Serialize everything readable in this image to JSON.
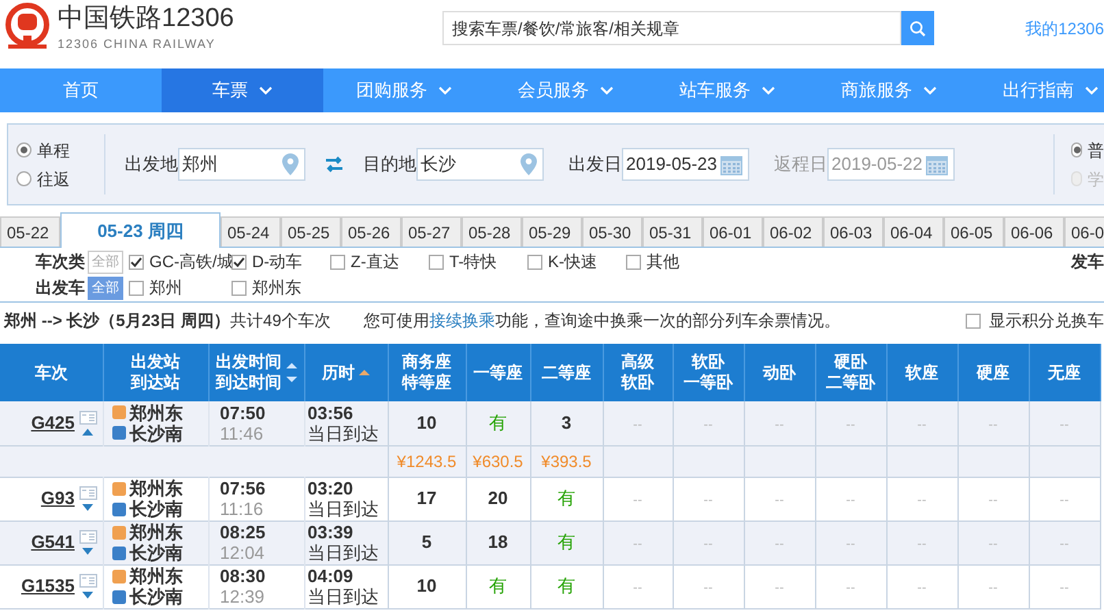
{
  "header": {
    "logo_title": "中国铁路12306",
    "logo_subtitle": "12306 CHINA RAILWAY",
    "search": {
      "placeholder": "搜索车票/餐饮/常旅客/相关规章"
    },
    "account_link": "我的12306"
  },
  "nav": [
    {
      "label": "首页",
      "selected": false,
      "has_menu": false
    },
    {
      "label": "车票",
      "selected": true,
      "has_menu": true
    },
    {
      "label": "团购服务",
      "selected": false,
      "has_menu": true
    },
    {
      "label": "会员服务",
      "selected": false,
      "has_menu": true
    },
    {
      "label": "站车服务",
      "selected": false,
      "has_menu": true
    },
    {
      "label": "商旅服务",
      "selected": false,
      "has_menu": true
    },
    {
      "label": "出行指南",
      "selected": false,
      "has_menu": true
    }
  ],
  "query": {
    "trip_types": [
      {
        "label": "单程",
        "selected": true
      },
      {
        "label": "往返",
        "selected": false
      }
    ],
    "from": {
      "label": "出发地",
      "value": "郑州"
    },
    "to": {
      "label": "目的地",
      "value": "长沙"
    },
    "depart_date": {
      "label": "出发日",
      "value": "2019-05-23",
      "disabled": false
    },
    "return_date": {
      "label": "返程日",
      "value": "2019-05-22",
      "disabled": true
    },
    "passenger_types": [
      {
        "label": "普",
        "selected": true,
        "disabled": false
      },
      {
        "label": "学",
        "selected": false,
        "disabled": true
      }
    ]
  },
  "date_tabs": [
    {
      "label": "05-22",
      "selected": false
    },
    {
      "label": "05-23 周四",
      "selected": true
    },
    {
      "label": "05-24",
      "selected": false
    },
    {
      "label": "05-25",
      "selected": false
    },
    {
      "label": "05-26",
      "selected": false
    },
    {
      "label": "05-27",
      "selected": false
    },
    {
      "label": "05-28",
      "selected": false
    },
    {
      "label": "05-29",
      "selected": false
    },
    {
      "label": "05-30",
      "selected": false
    },
    {
      "label": "05-31",
      "selected": false
    },
    {
      "label": "06-01",
      "selected": false
    },
    {
      "label": "06-02",
      "selected": false
    },
    {
      "label": "06-03",
      "selected": false
    },
    {
      "label": "06-04",
      "selected": false
    },
    {
      "label": "06-05",
      "selected": false
    },
    {
      "label": "06-06",
      "selected": false
    },
    {
      "label": "06-0",
      "selected": false
    }
  ],
  "filters": [
    {
      "label": "车次类",
      "all_label": "全部",
      "all_selected": false,
      "options": [
        {
          "label": "GC-高铁/城",
          "checked": true
        },
        {
          "label": "D-动车",
          "checked": true
        },
        {
          "label": "Z-直达",
          "checked": false
        },
        {
          "label": "T-特快",
          "checked": false
        },
        {
          "label": "K-快速",
          "checked": false
        },
        {
          "label": "其他",
          "checked": false
        }
      ],
      "extra": "发车"
    },
    {
      "label": "出发车",
      "all_label": "全部",
      "all_selected": true,
      "options": [
        {
          "label": "郑州",
          "checked": false
        },
        {
          "label": "郑州东",
          "checked": false
        }
      ]
    }
  ],
  "summary": {
    "route": "郑州 --> 长沙（5月23日  周四）",
    "count": "共计49个车次",
    "notice": "您可使用**接续换乘**功能，查询途中换乘一次的部分列车余票情况。",
    "option": {
      "label": "显示积分兑换车",
      "checked": false
    }
  },
  "table": {
    "columns": [
      {
        "lines": [
          "车次"
        ]
      },
      {
        "lines": [
          "出发站",
          "到达站"
        ]
      },
      {
        "lines": [
          "出发时间",
          "到达时间"
        ],
        "sort_up": true,
        "sort_down": true,
        "sorted": false
      },
      {
        "lines": [
          "历时"
        ],
        "sort_up": true,
        "sorted": true
      },
      {
        "lines": [
          "商务座",
          "特等座"
        ]
      },
      {
        "lines": [
          "一等座"
        ]
      },
      {
        "lines": [
          "二等座"
        ]
      },
      {
        "lines": [
          "高级",
          "软卧"
        ]
      },
      {
        "lines": [
          "软卧",
          "一等卧"
        ]
      },
      {
        "lines": [
          "动卧"
        ]
      },
      {
        "lines": [
          "硬卧",
          "二等卧"
        ]
      },
      {
        "lines": [
          "软座"
        ]
      },
      {
        "lines": [
          "硬座"
        ]
      },
      {
        "lines": [
          "无座"
        ]
      }
    ],
    "rows": [
      {
        "train": "G425",
        "expanded": true,
        "from": "郑州东",
        "to": "长沙南",
        "depart": "07:50",
        "arrive": "11:46",
        "duration": "03:56",
        "arrival_day": "当日到达",
        "seats": [
          {
            "text": "10",
            "kind": "count"
          },
          {
            "text": "有",
            "kind": "available"
          },
          {
            "text": "3",
            "kind": "count"
          },
          {
            "text": "--",
            "kind": "none"
          },
          {
            "text": "--",
            "kind": "none"
          },
          {
            "text": "--",
            "kind": "none"
          },
          {
            "text": "--",
            "kind": "none"
          },
          {
            "text": "--",
            "kind": "none"
          },
          {
            "text": "--",
            "kind": "none"
          },
          {
            "text": "--",
            "kind": "none"
          }
        ],
        "prices": [
          "¥1243.5",
          "¥630.5",
          "¥393.5"
        ]
      },
      {
        "train": "G93",
        "expanded": false,
        "from": "郑州东",
        "to": "长沙南",
        "depart": "07:56",
        "arrive": "11:16",
        "duration": "03:20",
        "arrival_day": "当日到达",
        "seats": [
          {
            "text": "17",
            "kind": "count"
          },
          {
            "text": "20",
            "kind": "count"
          },
          {
            "text": "有",
            "kind": "available"
          },
          {
            "text": "--",
            "kind": "none"
          },
          {
            "text": "--",
            "kind": "none"
          },
          {
            "text": "--",
            "kind": "none"
          },
          {
            "text": "--",
            "kind": "none"
          },
          {
            "text": "--",
            "kind": "none"
          },
          {
            "text": "--",
            "kind": "none"
          },
          {
            "text": "--",
            "kind": "none"
          }
        ]
      },
      {
        "train": "G541",
        "expanded": false,
        "from": "郑州东",
        "to": "长沙南",
        "depart": "08:25",
        "arrive": "12:04",
        "duration": "03:39",
        "arrival_day": "当日到达",
        "seats": [
          {
            "text": "5",
            "kind": "count"
          },
          {
            "text": "18",
            "kind": "count"
          },
          {
            "text": "有",
            "kind": "available"
          },
          {
            "text": "--",
            "kind": "none"
          },
          {
            "text": "--",
            "kind": "none"
          },
          {
            "text": "--",
            "kind": "none"
          },
          {
            "text": "--",
            "kind": "none"
          },
          {
            "text": "--",
            "kind": "none"
          },
          {
            "text": "--",
            "kind": "none"
          },
          {
            "text": "--",
            "kind": "none"
          }
        ]
      },
      {
        "train": "G1535",
        "expanded": false,
        "from": "郑州东",
        "to": "长沙南",
        "depart": "08:30",
        "arrive": "12:39",
        "duration": "04:09",
        "arrival_day": "当日到达",
        "seats": [
          {
            "text": "10",
            "kind": "count"
          },
          {
            "text": "有",
            "kind": "available"
          },
          {
            "text": "有",
            "kind": "available"
          },
          {
            "text": "--",
            "kind": "none"
          },
          {
            "text": "--",
            "kind": "none"
          },
          {
            "text": "--",
            "kind": "none"
          },
          {
            "text": "--",
            "kind": "none"
          },
          {
            "text": "--",
            "kind": "none"
          },
          {
            "text": "--",
            "kind": "none"
          },
          {
            "text": "--",
            "kind": "none"
          }
        ]
      }
    ]
  }
}
